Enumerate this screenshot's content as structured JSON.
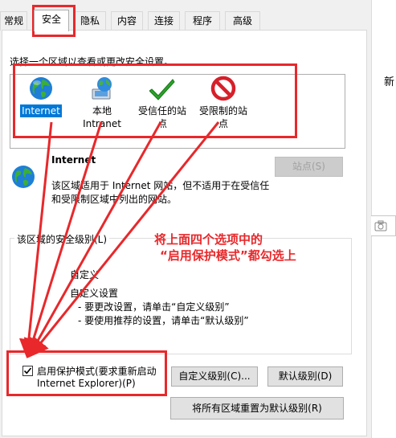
{
  "tabs": [
    "常规",
    "安全",
    "隐私",
    "内容",
    "连接",
    "程序",
    "高级"
  ],
  "active_tab": "安全",
  "zone_prompt": "选择一个区域以查看或更改安全设置。",
  "zones": [
    {
      "line1": "Internet",
      "line2": "",
      "icon": "globe-icon"
    },
    {
      "line1": "本地",
      "line2": "Intranet",
      "icon": "local-intranet-icon"
    },
    {
      "line1": "受信任的站",
      "line2": "点",
      "icon": "green-check-icon"
    },
    {
      "line1": "受限制的站",
      "line2": "点",
      "icon": "restricted-icon"
    }
  ],
  "zone_info": {
    "title": "Internet",
    "desc_line1": "该区域适用于 Internet 网站，但不适用于在受信任",
    "desc_line2": "和受限制区域中列出的网站。",
    "sites_button": "站点(S)"
  },
  "security_level": {
    "group_title": "该区域的安全级别(L)",
    "level_name": "自定义",
    "line1": "自定义设置",
    "line2": "- 要更改设置，请单击“自定义级别”",
    "line3": "- 要使用推荐的设置，请单击“默认级别”"
  },
  "protected_mode": {
    "line1": "启用保护模式(要求重新启动",
    "line2": "Internet Explorer)(P)",
    "checked": true
  },
  "buttons": {
    "custom_level": "自定义级别(C)...",
    "default_level": "默认级别(D)",
    "reset_all": "将所有区域重置为默认级别(R)"
  },
  "annotation": {
    "line1": "将上面四个选项中的",
    "line2": "“启用保护模式”都勾选上"
  },
  "side_text": "新",
  "colors": {
    "annotation_red": "#e8282b",
    "selection_blue": "#0078d7"
  }
}
